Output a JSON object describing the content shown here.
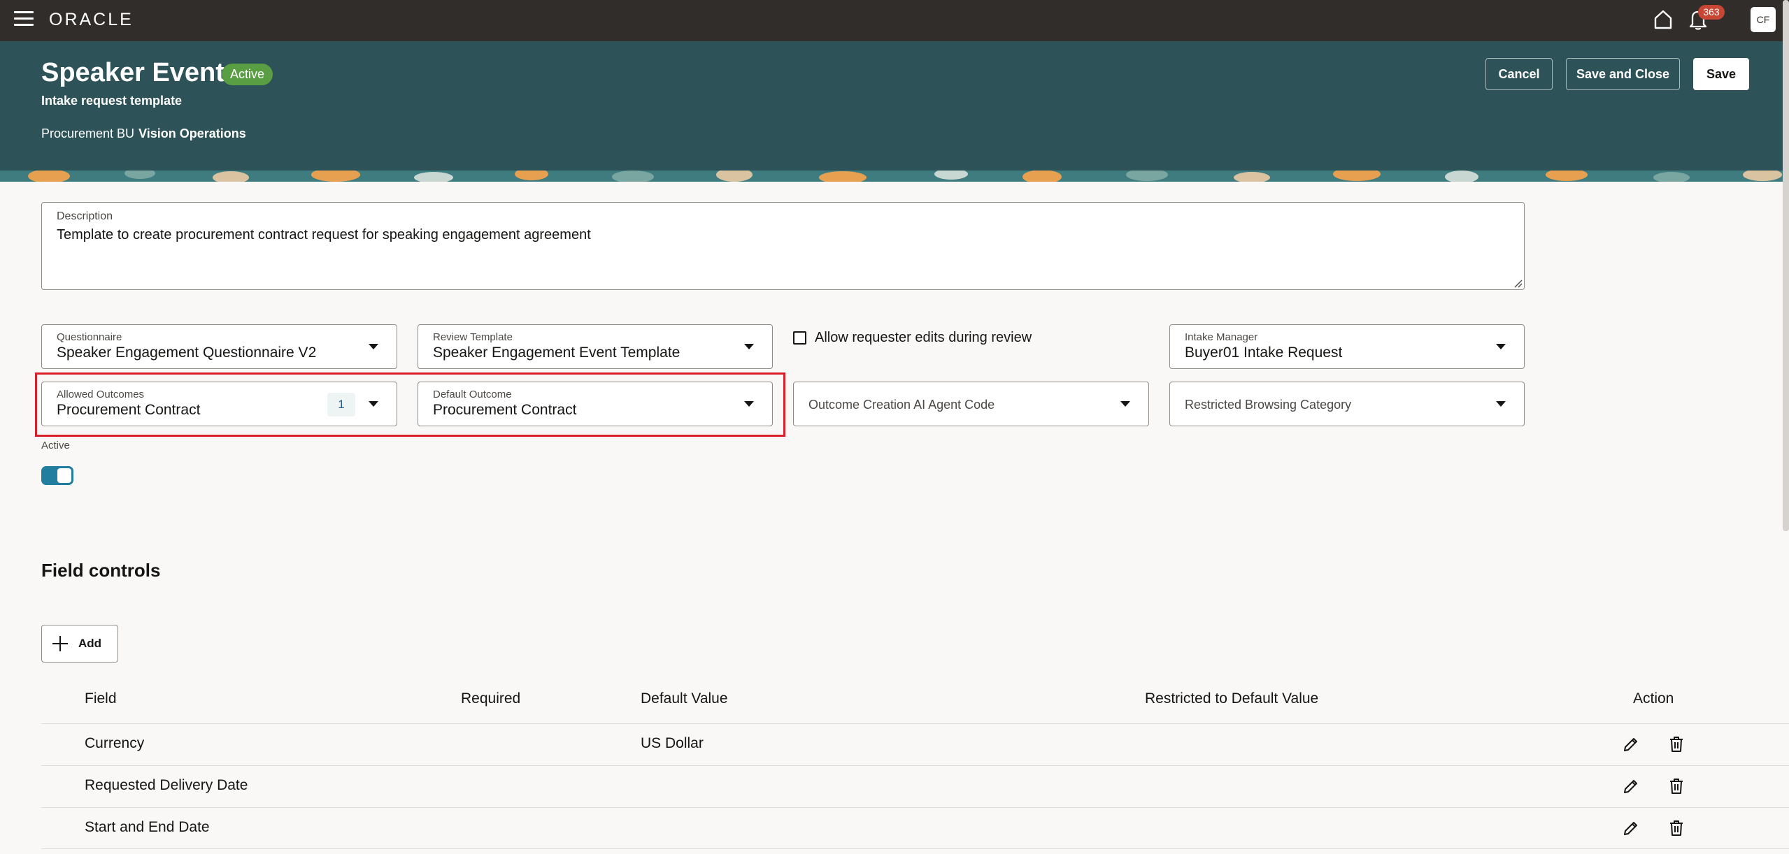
{
  "topbar": {
    "brand": "ORACLE",
    "notification_count": "363",
    "user_initials": "CF"
  },
  "header": {
    "title": "Speaker Event",
    "status": "Active",
    "subtitle": "Intake request template",
    "bu_label": "Procurement BU",
    "bu_value": "Vision Operations",
    "buttons": {
      "cancel": "Cancel",
      "save_and_close": "Save and Close",
      "save": "Save"
    }
  },
  "form": {
    "description": {
      "label": "Description",
      "value": "Template to create procurement contract request for speaking engagement agreement"
    },
    "questionnaire": {
      "label": "Questionnaire",
      "value": "Speaker Engagement Questionnaire V2"
    },
    "review_template": {
      "label": "Review Template",
      "value": "Speaker Engagement Event Template"
    },
    "allow_edits": {
      "label": "Allow requester edits during review",
      "checked": false
    },
    "intake_manager": {
      "label": "Intake Manager",
      "value": "Buyer01 Intake Request"
    },
    "allowed_outcomes": {
      "label": "Allowed Outcomes",
      "value": "Procurement Contract",
      "count": "1"
    },
    "default_outcome": {
      "label": "Default Outcome",
      "value": "Procurement Contract"
    },
    "outcome_ai_agent": {
      "placeholder": "Outcome Creation AI Agent Code"
    },
    "restricted_browsing": {
      "placeholder": "Restricted Browsing Category"
    },
    "active": {
      "label": "Active",
      "on": true
    }
  },
  "field_controls": {
    "title": "Field controls",
    "add_label": "Add",
    "columns": {
      "field": "Field",
      "required": "Required",
      "default_value": "Default Value",
      "restricted": "Restricted to Default Value",
      "action": "Action"
    },
    "rows": [
      {
        "field": "Currency",
        "required": "",
        "default_value": "US Dollar",
        "restricted": ""
      },
      {
        "field": "Requested Delivery Date",
        "required": "",
        "default_value": "",
        "restricted": ""
      },
      {
        "field": "Start and End Date",
        "required": "",
        "default_value": "",
        "restricted": ""
      }
    ]
  },
  "colors": {
    "topbar": "#312d2a",
    "header": "#2d5359",
    "status_badge": "#5a9e44",
    "highlight": "#d9202a",
    "toggle": "#227e9e",
    "notification": "#c74634"
  }
}
